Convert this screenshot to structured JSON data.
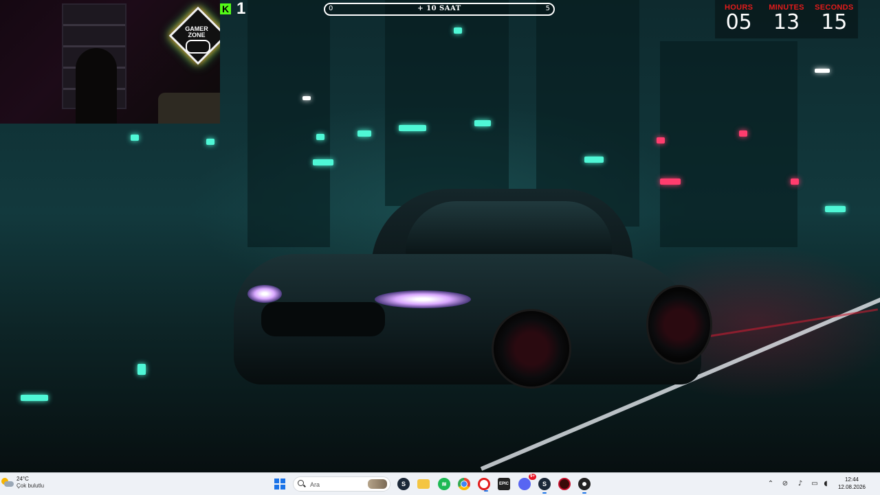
{
  "webcam": {
    "logo_text": [
      "GAMER",
      "ZONE"
    ]
  },
  "kick": {
    "icon": "kick-logo-icon",
    "brand_color": "#53fc18",
    "viewer_count": "1"
  },
  "subathon": {
    "min_label": "0",
    "center_label": "+ 10 SAAT",
    "max_label": "5"
  },
  "timer": {
    "hours_label": "HOURS",
    "minutes_label": "MINUTES",
    "seconds_label": "SECONDS",
    "hours": "05",
    "minutes": "13",
    "seconds": "15",
    "label_color": "#e31b1b"
  },
  "taskbar": {
    "weather": {
      "icon": "partly-cloudy-icon",
      "temperature": "24°C",
      "condition": "Çok bulutlu"
    },
    "start_icon": "windows-start-icon",
    "search": {
      "placeholder": "Ara",
      "icon": "search-icon"
    },
    "apps": [
      {
        "name": "steam",
        "icon": "steam-icon"
      },
      {
        "name": "file-explorer",
        "icon": "folder-icon"
      },
      {
        "name": "spotify",
        "icon": "spotify-icon"
      },
      {
        "name": "chrome",
        "icon": "chrome-icon"
      },
      {
        "name": "opera-gx",
        "icon": "opera-icon"
      },
      {
        "name": "epic-games",
        "icon": "epic-games-icon",
        "label": "EPIC"
      },
      {
        "name": "discord",
        "icon": "discord-icon",
        "badge": "9+"
      },
      {
        "name": "steam-2",
        "icon": "steam-icon"
      },
      {
        "name": "app-red",
        "icon": "red-app-icon"
      },
      {
        "name": "obs",
        "icon": "obs-icon"
      }
    ],
    "tray": {
      "icons": [
        "chevron-up-icon",
        "network-off-icon",
        "microphone-icon",
        "display-icon",
        "speaker-icon"
      ],
      "time": "12:44",
      "date": "12.08.2026"
    }
  }
}
